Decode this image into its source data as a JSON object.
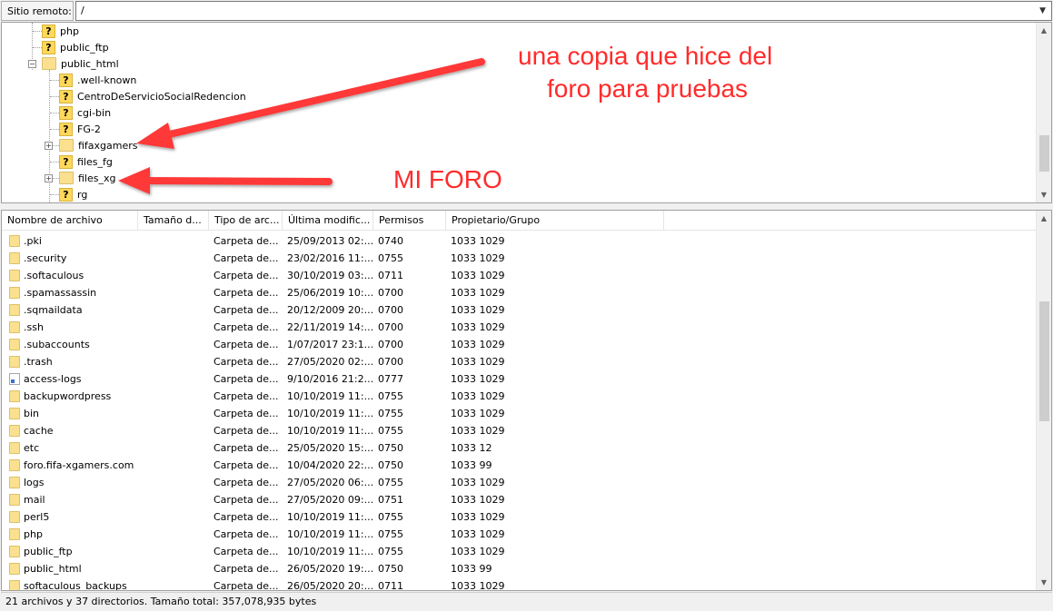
{
  "sitebar": {
    "label": "Sitio remoto:",
    "path": "/"
  },
  "tree": {
    "items": [
      {
        "label": "php",
        "icon": "question-folder-icon"
      },
      {
        "label": "public_ftp",
        "icon": "question-folder-icon"
      },
      {
        "label": "public_html",
        "icon": "folder-icon",
        "expanded": true
      },
      {
        "label": ".well-known",
        "icon": "question-folder-icon"
      },
      {
        "label": "CentroDeServicioSocialRedencion",
        "icon": "question-folder-icon"
      },
      {
        "label": "cgi-bin",
        "icon": "question-folder-icon"
      },
      {
        "label": "FG-2",
        "icon": "question-folder-icon"
      },
      {
        "label": "fifaxgamers",
        "icon": "folder-icon",
        "expandable": true
      },
      {
        "label": "files_fg",
        "icon": "question-folder-icon"
      },
      {
        "label": "files_xg",
        "icon": "folder-icon",
        "expandable": true
      },
      {
        "label": "rg",
        "icon": "question-folder-icon"
      }
    ]
  },
  "annotations": {
    "copy_line1": "una copia que hice del",
    "copy_line2": "foro para pruebas",
    "mine": "MI FORO",
    "color": "#ff2b2b"
  },
  "columns": [
    "Nombre de archivo",
    "Tamaño d...",
    "Tipo de arc...",
    "Última modific...",
    "Permisos",
    "Propietario/Grupo"
  ],
  "files": [
    {
      "name": ".pki",
      "type": "Carpeta de...",
      "modified": "25/09/2013 02:...",
      "perm": "0740",
      "owner": "1033 1029",
      "icon": "folder-icon"
    },
    {
      "name": ".security",
      "type": "Carpeta de...",
      "modified": "23/02/2016 11:...",
      "perm": "0755",
      "owner": "1033 1029",
      "icon": "folder-icon"
    },
    {
      "name": ".softaculous",
      "type": "Carpeta de...",
      "modified": "30/10/2019 03:...",
      "perm": "0711",
      "owner": "1033 1029",
      "icon": "folder-icon"
    },
    {
      "name": ".spamassassin",
      "type": "Carpeta de...",
      "modified": "25/06/2019 10:...",
      "perm": "0700",
      "owner": "1033 1029",
      "icon": "folder-icon"
    },
    {
      "name": ".sqmaildata",
      "type": "Carpeta de...",
      "modified": "20/12/2009 20:...",
      "perm": "0700",
      "owner": "1033 1029",
      "icon": "folder-icon"
    },
    {
      "name": ".ssh",
      "type": "Carpeta de...",
      "modified": "22/11/2019 14:...",
      "perm": "0700",
      "owner": "1033 1029",
      "icon": "folder-icon"
    },
    {
      "name": ".subaccounts",
      "type": "Carpeta de...",
      "modified": "1/07/2017 23:1...",
      "perm": "0700",
      "owner": "1033 1029",
      "icon": "folder-icon"
    },
    {
      "name": ".trash",
      "type": "Carpeta de...",
      "modified": "27/05/2020 02:...",
      "perm": "0700",
      "owner": "1033 1029",
      "icon": "folder-icon"
    },
    {
      "name": "access-logs",
      "type": "Carpeta de...",
      "modified": "9/10/2016 21:2...",
      "perm": "0777",
      "owner": "1033 1029",
      "icon": "link-icon"
    },
    {
      "name": "backupwordpress",
      "type": "Carpeta de...",
      "modified": "10/10/2019 11:...",
      "perm": "0755",
      "owner": "1033 1029",
      "icon": "folder-icon"
    },
    {
      "name": "bin",
      "type": "Carpeta de...",
      "modified": "10/10/2019 11:...",
      "perm": "0755",
      "owner": "1033 1029",
      "icon": "folder-icon"
    },
    {
      "name": "cache",
      "type": "Carpeta de...",
      "modified": "10/10/2019 11:...",
      "perm": "0755",
      "owner": "1033 1029",
      "icon": "folder-icon"
    },
    {
      "name": "etc",
      "type": "Carpeta de...",
      "modified": "25/05/2020 15:...",
      "perm": "0750",
      "owner": "1033 12",
      "icon": "folder-icon"
    },
    {
      "name": "foro.fifa-xgamers.com",
      "type": "Carpeta de...",
      "modified": "10/04/2020 22:...",
      "perm": "0750",
      "owner": "1033 99",
      "icon": "folder-icon"
    },
    {
      "name": "logs",
      "type": "Carpeta de...",
      "modified": "27/05/2020 06:...",
      "perm": "0755",
      "owner": "1033 1029",
      "icon": "folder-icon"
    },
    {
      "name": "mail",
      "type": "Carpeta de...",
      "modified": "27/05/2020 09:...",
      "perm": "0751",
      "owner": "1033 1029",
      "icon": "folder-icon"
    },
    {
      "name": "perl5",
      "type": "Carpeta de...",
      "modified": "10/10/2019 11:...",
      "perm": "0755",
      "owner": "1033 1029",
      "icon": "folder-icon"
    },
    {
      "name": "php",
      "type": "Carpeta de...",
      "modified": "10/10/2019 11:...",
      "perm": "0755",
      "owner": "1033 1029",
      "icon": "folder-icon"
    },
    {
      "name": "public_ftp",
      "type": "Carpeta de...",
      "modified": "10/10/2019 11:...",
      "perm": "0755",
      "owner": "1033 1029",
      "icon": "folder-icon"
    },
    {
      "name": "public_html",
      "type": "Carpeta de...",
      "modified": "26/05/2020 19:...",
      "perm": "0750",
      "owner": "1033 99",
      "icon": "folder-icon"
    },
    {
      "name": "softaculous_backups",
      "type": "Carpeta de...",
      "modified": "26/05/2020 20:...",
      "perm": "0711",
      "owner": "1033 1029",
      "icon": "folder-icon"
    }
  ],
  "status": "21 archivos y 37 directorios. Tamaño total: 357,078,935 bytes"
}
